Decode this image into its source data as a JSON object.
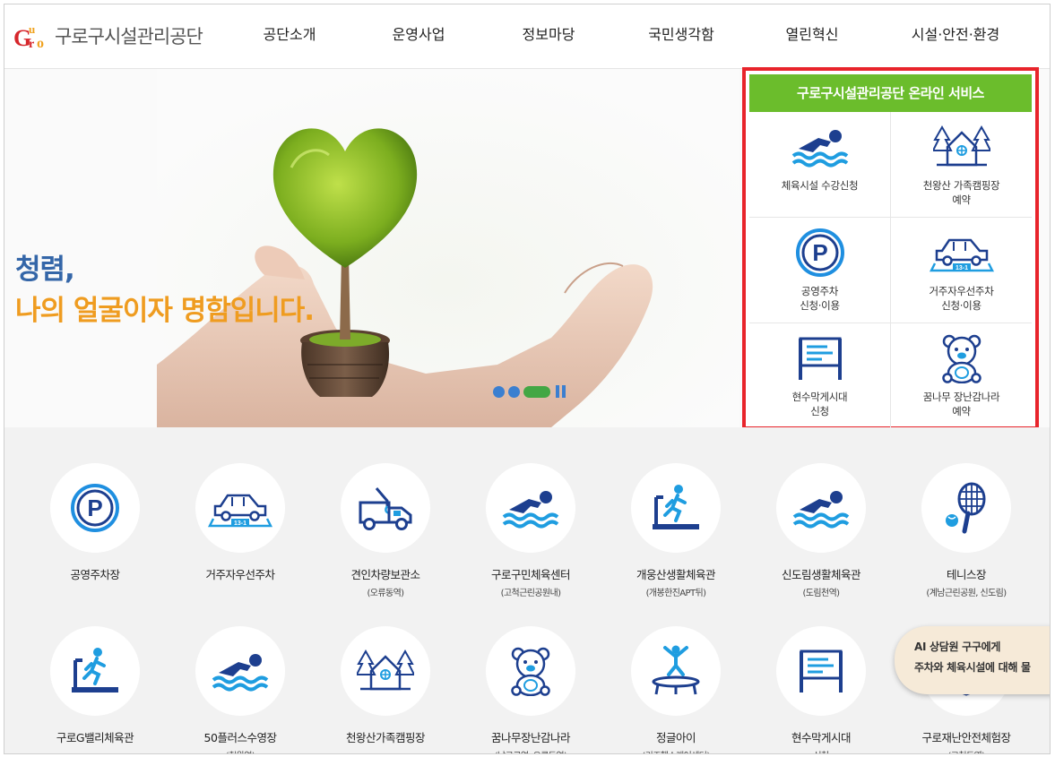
{
  "header": {
    "logo_text": "구로구시설관리공단",
    "nav": [
      "공단소개",
      "운영사업",
      "정보마당",
      "국민생각함",
      "열린혁신",
      "시설·안전·환경"
    ]
  },
  "hero": {
    "line1": "청렴,",
    "line2": "나의 얼굴이자 명함입니다."
  },
  "online_service": {
    "title": "구로구시설관리공단 온라인 서비스",
    "items": [
      {
        "label": "체육시설 수강신청",
        "icon": "swimmer-icon"
      },
      {
        "label": "천왕산 가족캠핑장\n예약",
        "icon": "campsite-icon"
      },
      {
        "label": "공영주차\n신청·이용",
        "icon": "parking-icon"
      },
      {
        "label": "거주자우선주차\n신청·이용",
        "icon": "resident-parking-icon"
      },
      {
        "label": "현수막게시대\n신청",
        "icon": "banner-board-icon"
      },
      {
        "label": "꿈나무 장난감나라\n예약",
        "icon": "teddy-bear-icon"
      }
    ]
  },
  "facilities": [
    {
      "name": "공영주차장",
      "sub": "",
      "icon": "parking-icon"
    },
    {
      "name": "거주자우선주차",
      "sub": "",
      "icon": "resident-parking-icon"
    },
    {
      "name": "견인차량보관소",
      "sub": "(오류동역)",
      "icon": "tow-truck-icon"
    },
    {
      "name": "구로구민체육센터",
      "sub": "(고척근린공원내)",
      "icon": "swimmer-icon"
    },
    {
      "name": "개웅산생활체육관",
      "sub": "(개봉한진APT뒤)",
      "icon": "treadmill-icon"
    },
    {
      "name": "신도림생활체육관",
      "sub": "(도림천역)",
      "icon": "swimmer-icon"
    },
    {
      "name": "테니스장",
      "sub": "(계남근린공원, 신도림)",
      "icon": "tennis-icon"
    },
    {
      "name": "구로G밸리체육관",
      "sub": "",
      "icon": "treadmill-icon"
    },
    {
      "name": "50플러스수영장",
      "sub": "(천왕역)",
      "icon": "swimmer-icon"
    },
    {
      "name": "천왕산가족캠핑장",
      "sub": "",
      "icon": "campsite-icon"
    },
    {
      "name": "꿈나무장난감나라",
      "sub": "(남구로역, 오류동역)",
      "icon": "teddy-bear-icon"
    },
    {
      "name": "정글아이",
      "sub": "(키즈헬스케어센터)",
      "icon": "trampoline-icon"
    },
    {
      "name": "현수막게시대",
      "sub": "신청",
      "icon": "banner-board-icon"
    },
    {
      "name": "구로재난안전체험장",
      "sub": "(고척돔옆)",
      "icon": "safety-icon"
    }
  ],
  "chat": {
    "line1": "AI 상담원 구구에게",
    "line2": "주차와 체육시설에 대해 물"
  },
  "colors": {
    "icon_blue": "#1f6fd1",
    "icon_navy": "#1d3f8f",
    "green_head": "#6bbd2c",
    "highlight_red": "#e8242b",
    "hero_blue": "#3466a8",
    "hero_orange": "#ef9c20"
  }
}
